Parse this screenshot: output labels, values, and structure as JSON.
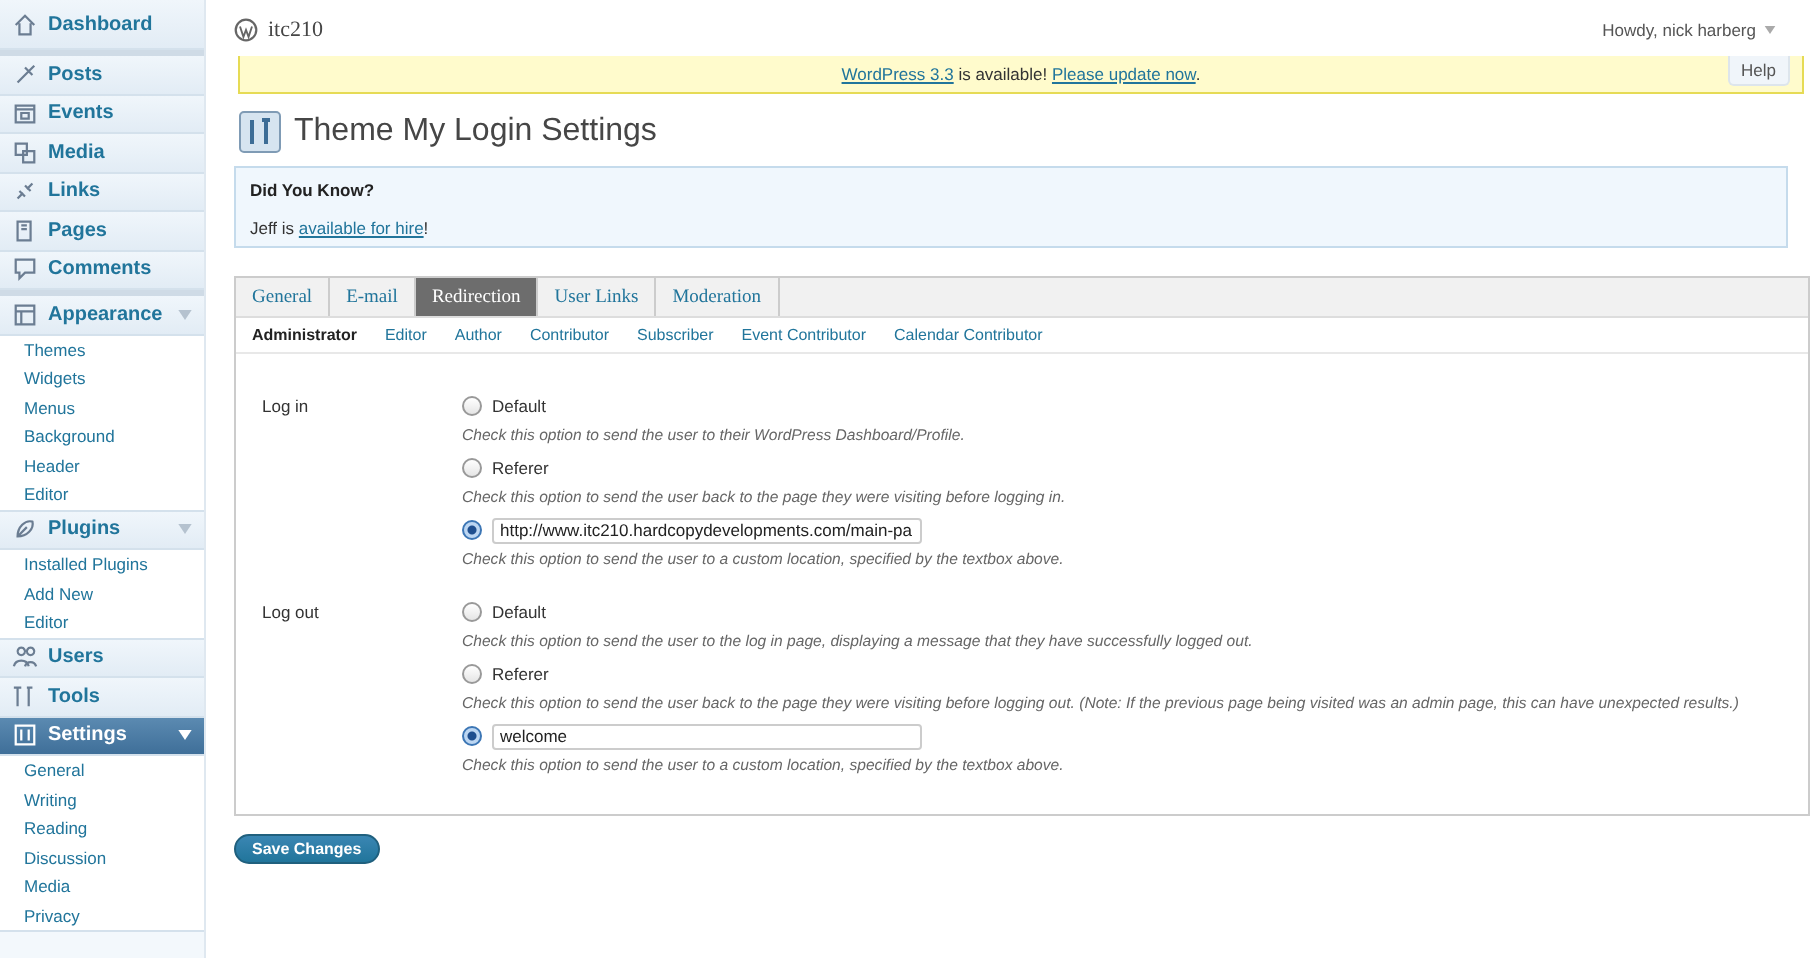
{
  "sidebar": {
    "items": [
      {
        "label": "Dashboard",
        "group_start": false,
        "current": false,
        "expanded": false
      },
      {
        "label": "Posts",
        "group_start": true,
        "current": false,
        "expanded": false
      },
      {
        "label": "Events",
        "group_start": false,
        "current": false,
        "expanded": false
      },
      {
        "label": "Media",
        "group_start": false,
        "current": false,
        "expanded": false
      },
      {
        "label": "Links",
        "group_start": false,
        "current": false,
        "expanded": false
      },
      {
        "label": "Pages",
        "group_start": false,
        "current": false,
        "expanded": false
      },
      {
        "label": "Comments",
        "group_start": false,
        "current": false,
        "expanded": false
      },
      {
        "label": "Appearance",
        "group_start": true,
        "current": false,
        "expanded": true,
        "children": [
          "Themes",
          "Widgets",
          "Menus",
          "Background",
          "Header",
          "Editor"
        ]
      },
      {
        "label": "Plugins",
        "group_start": false,
        "current": false,
        "expanded": true,
        "children": [
          "Installed Plugins",
          "Add New",
          "Editor"
        ]
      },
      {
        "label": "Users",
        "group_start": false,
        "current": false,
        "expanded": false
      },
      {
        "label": "Tools",
        "group_start": false,
        "current": false,
        "expanded": false
      },
      {
        "label": "Settings",
        "group_start": false,
        "current": true,
        "expanded": true,
        "children": [
          "General",
          "Writing",
          "Reading",
          "Discussion",
          "Media",
          "Privacy"
        ]
      }
    ]
  },
  "header": {
    "site_title": "itc210",
    "greeting": "Howdy, nick harberg"
  },
  "notice": {
    "parts": [
      {
        "kind": "link",
        "text": "WordPress 3.3"
      },
      {
        "kind": "text",
        "text": " is available! "
      },
      {
        "kind": "link",
        "text": "Please update now"
      },
      {
        "kind": "text",
        "text": "."
      }
    ]
  },
  "help_button": "Help",
  "page_title": "Theme My Login Settings",
  "info_box": {
    "heading": "Did You Know?",
    "parts": [
      {
        "kind": "text",
        "text": "Jeff is "
      },
      {
        "kind": "link",
        "text": "available for hire"
      },
      {
        "kind": "text",
        "text": "!"
      }
    ]
  },
  "tabs": [
    {
      "label": "General",
      "selected": false
    },
    {
      "label": "E-mail",
      "selected": false
    },
    {
      "label": "Redirection",
      "selected": true
    },
    {
      "label": "User Links",
      "selected": false
    },
    {
      "label": "Moderation",
      "selected": false
    }
  ],
  "subtabs": [
    {
      "label": "Administrator",
      "selected": true
    },
    {
      "label": "Editor",
      "selected": false
    },
    {
      "label": "Author",
      "selected": false
    },
    {
      "label": "Contributor",
      "selected": false
    },
    {
      "label": "Subscriber",
      "selected": false
    },
    {
      "label": "Event Contributor",
      "selected": false
    },
    {
      "label": "Calendar Contributor",
      "selected": false
    }
  ],
  "sections": [
    {
      "label": "Log in",
      "options": [
        {
          "kind": "radio",
          "label": "Default",
          "selected": false,
          "description": "Check this option to send the user to their WordPress Dashboard/Profile."
        },
        {
          "kind": "radio",
          "label": "Referer",
          "selected": false,
          "description": "Check this option to send the user back to the page they were visiting before logging in."
        },
        {
          "kind": "field",
          "value": "http://www.itc210.hardcopydevelopments.com/main-pa",
          "selected": true,
          "description": "Check this option to send the user to a custom location, specified by the textbox above."
        }
      ]
    },
    {
      "label": "Log out",
      "options": [
        {
          "kind": "radio",
          "label": "Default",
          "selected": false,
          "description": "Check this option to send the user to the log in page, displaying a message that they have successfully logged out."
        },
        {
          "kind": "radio",
          "label": "Referer",
          "selected": false,
          "description": "Check this option to send the user back to the page they were visiting before logging out. (Note: If the previous page being visited was an admin page, this can have unexpected results.)"
        },
        {
          "kind": "field",
          "value": "welcome",
          "selected": true,
          "description": "Check this option to send the user to a custom location, specified by the textbox above."
        }
      ]
    }
  ],
  "save_button": "Save Changes"
}
